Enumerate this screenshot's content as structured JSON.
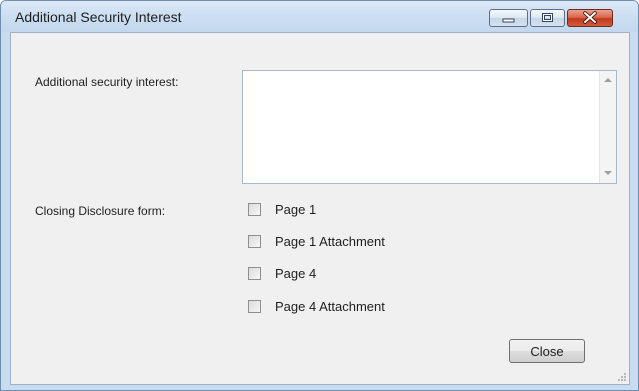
{
  "window": {
    "title": "Additional Security Interest",
    "controls": {
      "minimize_icon": "minimize-icon",
      "maximize_icon": "maximize-icon",
      "close_icon": "close-icon"
    }
  },
  "form": {
    "additional_security_label": "Additional security interest:",
    "additional_security_value": "",
    "closing_disclosure_label": "Closing Disclosure form:",
    "checkboxes": [
      {
        "label": "Page 1",
        "checked": false
      },
      {
        "label": "Page 1 Attachment",
        "checked": false
      },
      {
        "label": "Page 4",
        "checked": false
      },
      {
        "label": "Page 4 Attachment",
        "checked": false
      }
    ]
  },
  "buttons": {
    "close_label": "Close"
  },
  "colors": {
    "titlebar": "#cddff2",
    "client_background": "#f0f0f0",
    "close_button_red": "#c0391d"
  }
}
